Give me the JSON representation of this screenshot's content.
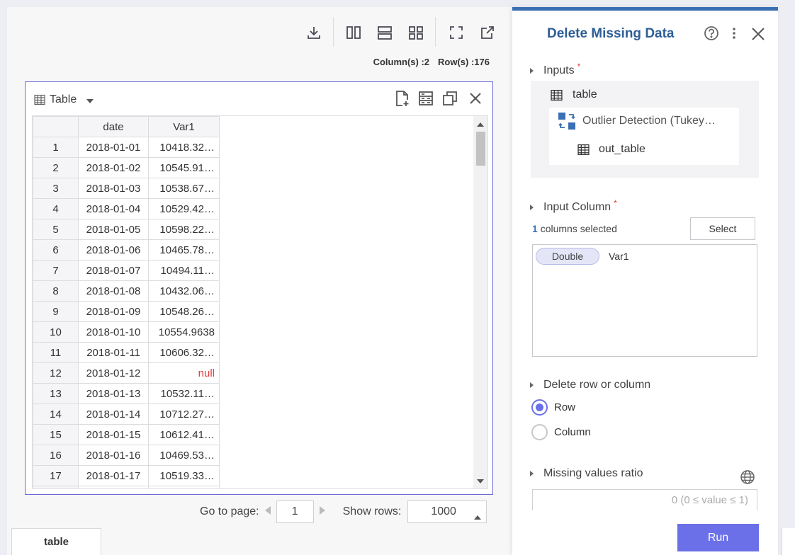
{
  "toolbar": {
    "icons": [
      "download-icon",
      "layout-columns-icon",
      "layout-rows-icon",
      "layout-grid-icon",
      "fullscreen-icon",
      "open-external-icon"
    ],
    "columns_count": "Column(s) :2",
    "rows_count": "Row(s) :176"
  },
  "card": {
    "view_label": "Table",
    "header_icons": [
      "new-file-icon",
      "column-settings-icon",
      "copy-window-icon",
      "close-icon"
    ]
  },
  "grid": {
    "headers": [
      "",
      "date",
      "Var1"
    ],
    "rows": [
      {
        "n": "1",
        "date": "2018-01-01",
        "val": "10418.32…"
      },
      {
        "n": "2",
        "date": "2018-01-02",
        "val": "10545.91…"
      },
      {
        "n": "3",
        "date": "2018-01-03",
        "val": "10538.67…"
      },
      {
        "n": "4",
        "date": "2018-01-04",
        "val": "10529.42…"
      },
      {
        "n": "5",
        "date": "2018-01-05",
        "val": "10598.22…"
      },
      {
        "n": "6",
        "date": "2018-01-06",
        "val": "10465.78…"
      },
      {
        "n": "7",
        "date": "2018-01-07",
        "val": "10494.11…"
      },
      {
        "n": "8",
        "date": "2018-01-08",
        "val": "10432.06…"
      },
      {
        "n": "9",
        "date": "2018-01-09",
        "val": "10548.26…"
      },
      {
        "n": "10",
        "date": "2018-01-10",
        "val": "10554.9638"
      },
      {
        "n": "11",
        "date": "2018-01-11",
        "val": "10606.32…"
      },
      {
        "n": "12",
        "date": "2018-01-12",
        "val": "null"
      },
      {
        "n": "13",
        "date": "2018-01-13",
        "val": "10532.11…"
      },
      {
        "n": "14",
        "date": "2018-01-14",
        "val": "10712.27…"
      },
      {
        "n": "15",
        "date": "2018-01-15",
        "val": "10612.41…"
      },
      {
        "n": "16",
        "date": "2018-01-16",
        "val": "10469.53…"
      },
      {
        "n": "17",
        "date": "2018-01-17",
        "val": "10519.33…"
      }
    ],
    "null_color": "#e53b3b"
  },
  "pager": {
    "goto_label": "Go to page:",
    "page_value": "1",
    "show_rows_label": "Show rows:",
    "rows_value": "1000"
  },
  "bottom_tab": {
    "label": "table"
  },
  "panel": {
    "title": "Delete Missing Data",
    "inputs_label": "Inputs",
    "input_table": "table",
    "input_model": "Outlier Detection (Tukey…",
    "input_output": "out_table",
    "input_column_label": "Input Column",
    "selected_count": "1",
    "selected_text": "columns selected",
    "select_button": "Select",
    "column_type": "Double",
    "column_name": "Var1",
    "delete_section": "Delete row or column",
    "option_row": "Row",
    "option_column": "Column",
    "selected_option": "Row",
    "ratio_label": "Missing values ratio",
    "ratio_placeholder": "0 (0 ≤ value ≤ 1)",
    "run_button": "Run"
  },
  "colors": {
    "accent": "#6b70e8",
    "title_blue": "#2e5e96",
    "panel_top": "#3a6fb4"
  }
}
